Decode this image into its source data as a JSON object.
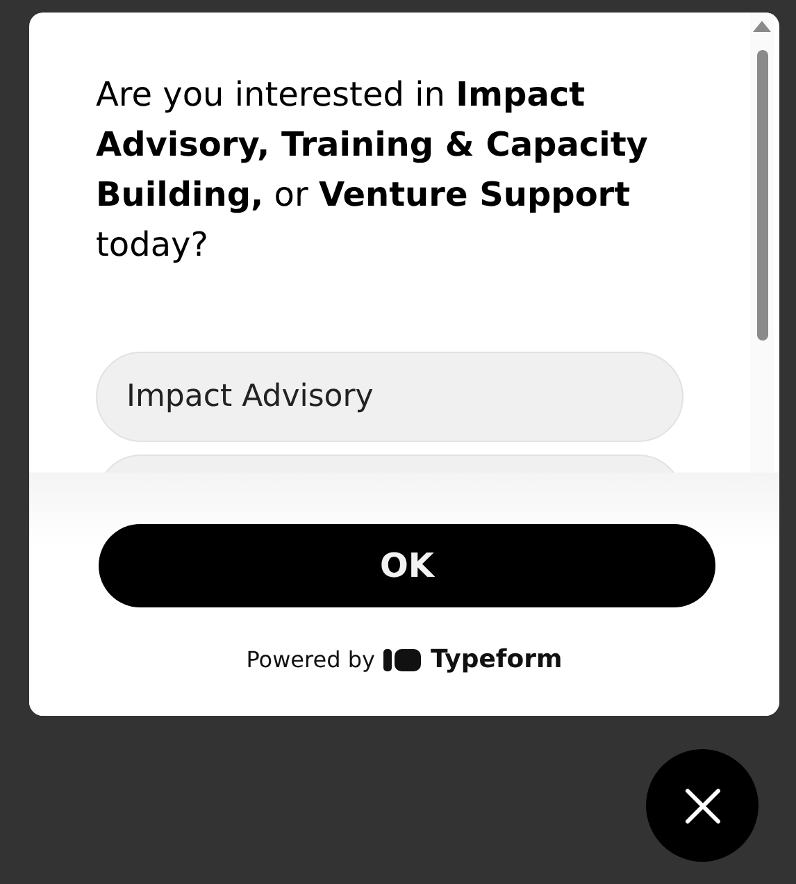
{
  "question": "Are you interested in **Impact Advisory, Training & Capacity Building,** or **Venture Support** today?",
  "options": [
    {
      "label": "Impact Advisory"
    }
  ],
  "submit_button": "OK",
  "branding": {
    "prefix": "Powered by",
    "brand": "Typeform"
  }
}
